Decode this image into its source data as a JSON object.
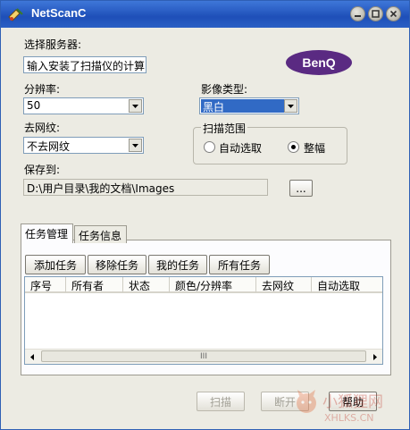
{
  "window": {
    "title": "NetScanC",
    "icon": "scanner-icon"
  },
  "brand": {
    "logo_text": "BenQ",
    "logo_color": "#5a2a82"
  },
  "server": {
    "label": "选择服务器:",
    "value": "输入安装了扫描仪的计算"
  },
  "resolution": {
    "label": "分辨率:",
    "value": "50"
  },
  "image_type": {
    "label": "影像类型:",
    "value": "黑白"
  },
  "descreen": {
    "label": "去网纹:",
    "value": "不去网纹"
  },
  "scan_range": {
    "label": "扫描范围",
    "auto_label": "自动选取",
    "full_label": "整幅",
    "selected": "整幅"
  },
  "save_to": {
    "label": "保存到:",
    "path": "D:\\用户目录\\我的文档\\Images",
    "browse_label": "..."
  },
  "tabs": [
    {
      "label": "任务管理",
      "active": true
    },
    {
      "label": "任务信息",
      "active": false
    }
  ],
  "task_buttons": {
    "add": "添加任务",
    "remove": "移除任务",
    "mine": "我的任务",
    "all": "所有任务"
  },
  "columns": [
    "序号",
    "所有者",
    "状态",
    "颜色/分辨率",
    "去网纹",
    "自动选取"
  ],
  "rows": [],
  "scrollbar": {
    "thumb_label": "III"
  },
  "footer": {
    "scan": "扫描",
    "disconnect": "断开",
    "help": "帮助"
  },
  "watermark": {
    "text": "小狐狸网",
    "url": "XHLKS.CN"
  },
  "colors": {
    "titlebar": "#1e4fb8",
    "selection": "#316ac5",
    "window_bg": "#ecebe3"
  }
}
